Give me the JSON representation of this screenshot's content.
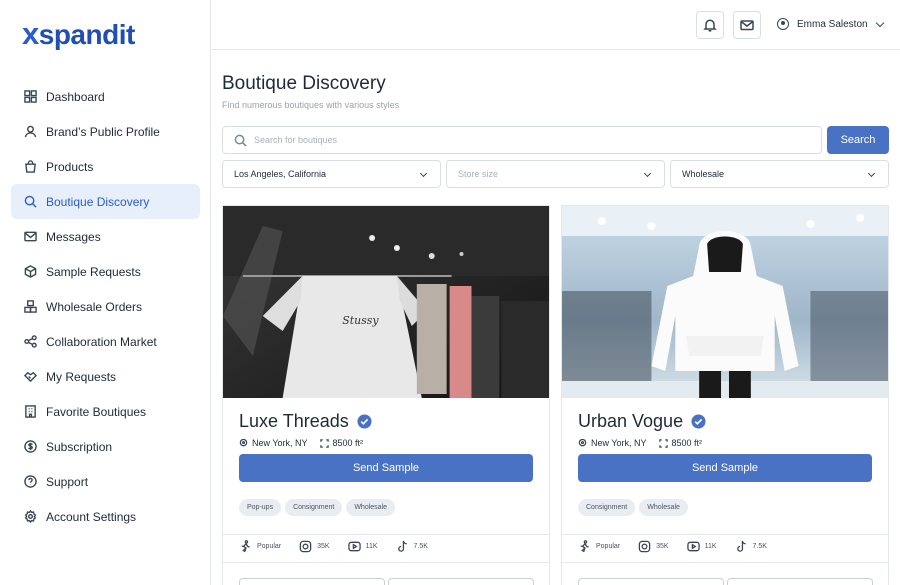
{
  "brand": {
    "logo": "xspandit"
  },
  "sidebar": {
    "items": [
      {
        "label": "Dashboard",
        "icon": "dashboard-icon"
      },
      {
        "label": "Brand’s Public Profile",
        "icon": "user-icon"
      },
      {
        "label": "Products",
        "icon": "bag-icon"
      },
      {
        "label": "Boutique Discovery",
        "icon": "search-icon",
        "active": true
      },
      {
        "label": "Messages",
        "icon": "mail-icon"
      },
      {
        "label": "Sample Requests",
        "icon": "box-icon"
      },
      {
        "label": "Wholesale Orders",
        "icon": "boxes-icon"
      },
      {
        "label": "Collaboration Market",
        "icon": "share-icon"
      },
      {
        "label": "My Requests",
        "icon": "handshake-icon"
      },
      {
        "label": "Favorite Boutiques",
        "icon": "building-icon"
      },
      {
        "label": "Subscription",
        "icon": "dollar-icon"
      },
      {
        "label": "Support",
        "icon": "help-icon"
      },
      {
        "label": "Account Settings",
        "icon": "settings-icon"
      }
    ]
  },
  "header": {
    "user_name": "Emma Saleston"
  },
  "page": {
    "title": "Boutique Discovery",
    "subtitle": "Find numerous boutiques with various styles"
  },
  "search": {
    "placeholder": "Search for boutiques",
    "button": "Search"
  },
  "filters": {
    "location": "Los Angeles, California",
    "store_size_placeholder": "Store size",
    "type": "Wholesale"
  },
  "cards": [
    {
      "name": "Luxe Threads",
      "location": "New York, NY",
      "size": "8500 ft²",
      "button": "Send Sample",
      "tags": [
        "Pop-ups",
        "Consignment",
        "Wholesale"
      ],
      "stats": {
        "popular": "Popular",
        "instagram": "35K",
        "youtube": "11K",
        "tiktok": "7.5K"
      }
    },
    {
      "name": "Urban Vogue",
      "location": "New York, NY",
      "size": "8500 ft²",
      "button": "Send Sample",
      "tags": [
        "Consignment",
        "Wholesale"
      ],
      "stats": {
        "popular": "Popular",
        "instagram": "35K",
        "youtube": "11K",
        "tiktok": "7.5K"
      }
    }
  ],
  "colors": {
    "brand": "#1f4fb4",
    "primary_button": "#4a72c4",
    "active_bg": "#e7effb",
    "tag_bg": "#e9ecf0"
  }
}
